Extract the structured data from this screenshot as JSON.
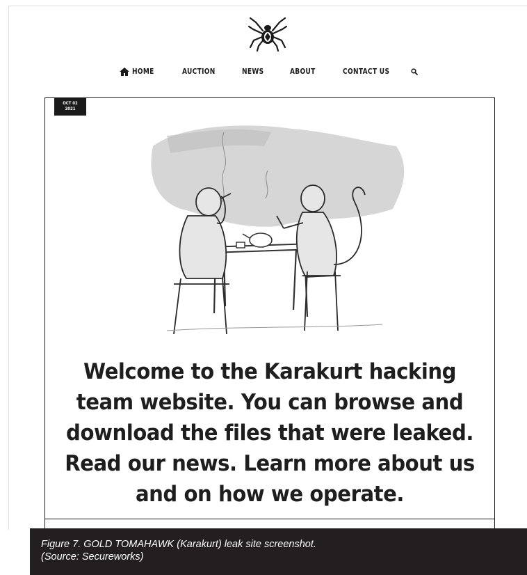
{
  "nav": {
    "items": [
      {
        "label": "HOME"
      },
      {
        "label": "AUCTION"
      },
      {
        "label": "NEWS"
      },
      {
        "label": "ABOUT"
      },
      {
        "label": "CONTACT US"
      }
    ]
  },
  "post": {
    "date_month_day": "OCT 02",
    "date_year": "2021",
    "headline": "Welcome to the Karakurt hacking team website. You can browse and download the files that were leaked. Read our news. Learn more about us and on how we operate."
  },
  "caption": {
    "line1": "Figure 7. GOLD TOMAHAWK (Karakurt) leak site screenshot.",
    "line2": "(Source: Secureworks)"
  },
  "colors": {
    "text": "#1e1e1e",
    "badge_bg": "#1a1a1a",
    "caption_bg": "#231f20"
  },
  "icons": [
    "spider-logo-icon",
    "home-icon",
    "search-icon"
  ]
}
